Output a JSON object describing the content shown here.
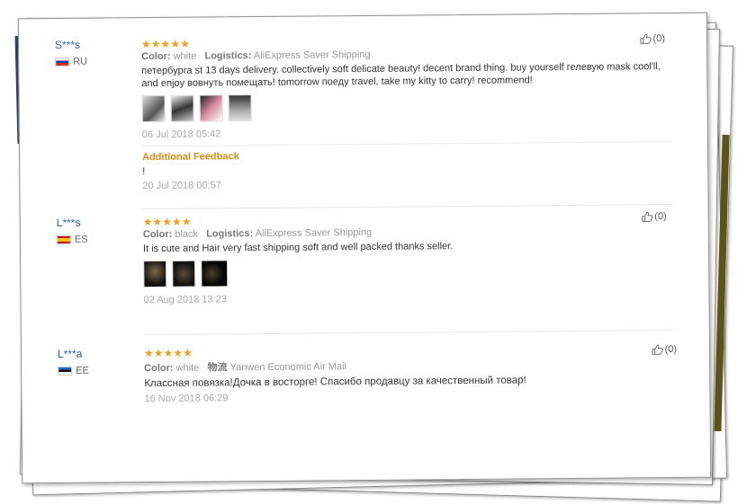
{
  "reviews": [
    {
      "user": "S***s",
      "country": "RU",
      "stars": "★★★★★",
      "color_label": "Color:",
      "color_value": "white",
      "logistics_label": "Logistics:",
      "logistics_value": "AliExpress Saver Shipping",
      "text": "петербурга st 13 days delivery. collectively soft delicate beauty! decent brand thing. buy yourself гелевую mask cool'll, and enjoy вовнуть помещать! tomorrow поеду travel, take my kitty to carry! recommend!",
      "date": "06 Jul 2018 05:42",
      "additional_label": "Additional Feedback",
      "additional_text": "!",
      "additional_date": "20 Jul 2018 00:57",
      "likes": "(0)"
    },
    {
      "user": "L***s",
      "country": "ES",
      "stars": "★★★★★",
      "color_label": "Color:",
      "color_value": "black",
      "logistics_label": "Logistics:",
      "logistics_value": "AliExpress Saver Shipping",
      "text": "It is cute and Hair very fast shipping soft and well packed thanks seller.",
      "date": "02 Aug 2018 13:23",
      "likes": "(0)"
    },
    {
      "user": "L***a",
      "country": "EE",
      "stars": "★★★★★",
      "color_label": "Color:",
      "color_value": "white",
      "logistics_label": "物流",
      "logistics_value": "Yanwen Economic Air Mail",
      "text": "Классная повязка!Дочка в восторге! Спасибо продавцу за качественный товар!",
      "date": "16 Nov 2018 06:29",
      "likes": "(0)"
    }
  ],
  "icons": {
    "like": "thumbs-up-icon",
    "flag_ru": "flag-ru-icon",
    "flag_es": "flag-es-icon",
    "flag_ee": "flag-ee-icon"
  },
  "colors": {
    "username": "#1f5fb4",
    "stars": "#f89c1c",
    "additional_feedback": "#e28b12"
  }
}
